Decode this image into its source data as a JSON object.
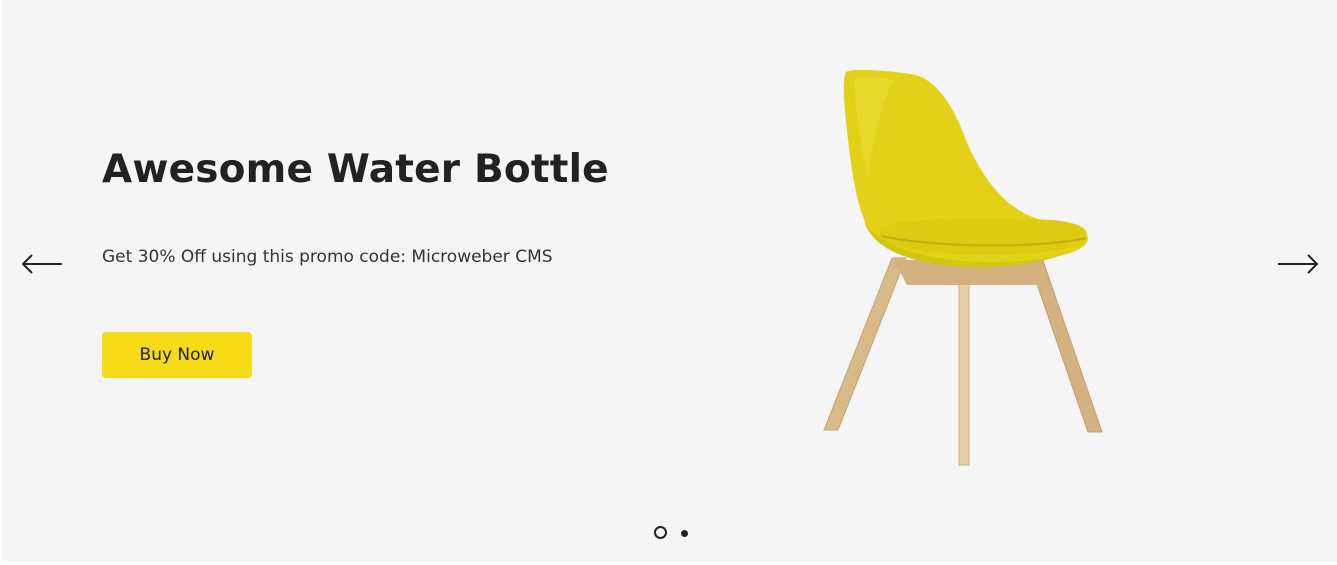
{
  "slide": {
    "title": "Awesome Water Bottle",
    "text": "Get 30% Off using this promo code: Microweber CMS",
    "button_label": "Buy Now",
    "image": "yellow-chair"
  },
  "navigation": {
    "prev_icon": "arrow-left-icon",
    "next_icon": "arrow-right-icon"
  },
  "pagination": {
    "count": 2,
    "active_index": 0
  },
  "colors": {
    "background": "#f5f5f5",
    "accent": "#f5dc17",
    "text": "#222222"
  }
}
